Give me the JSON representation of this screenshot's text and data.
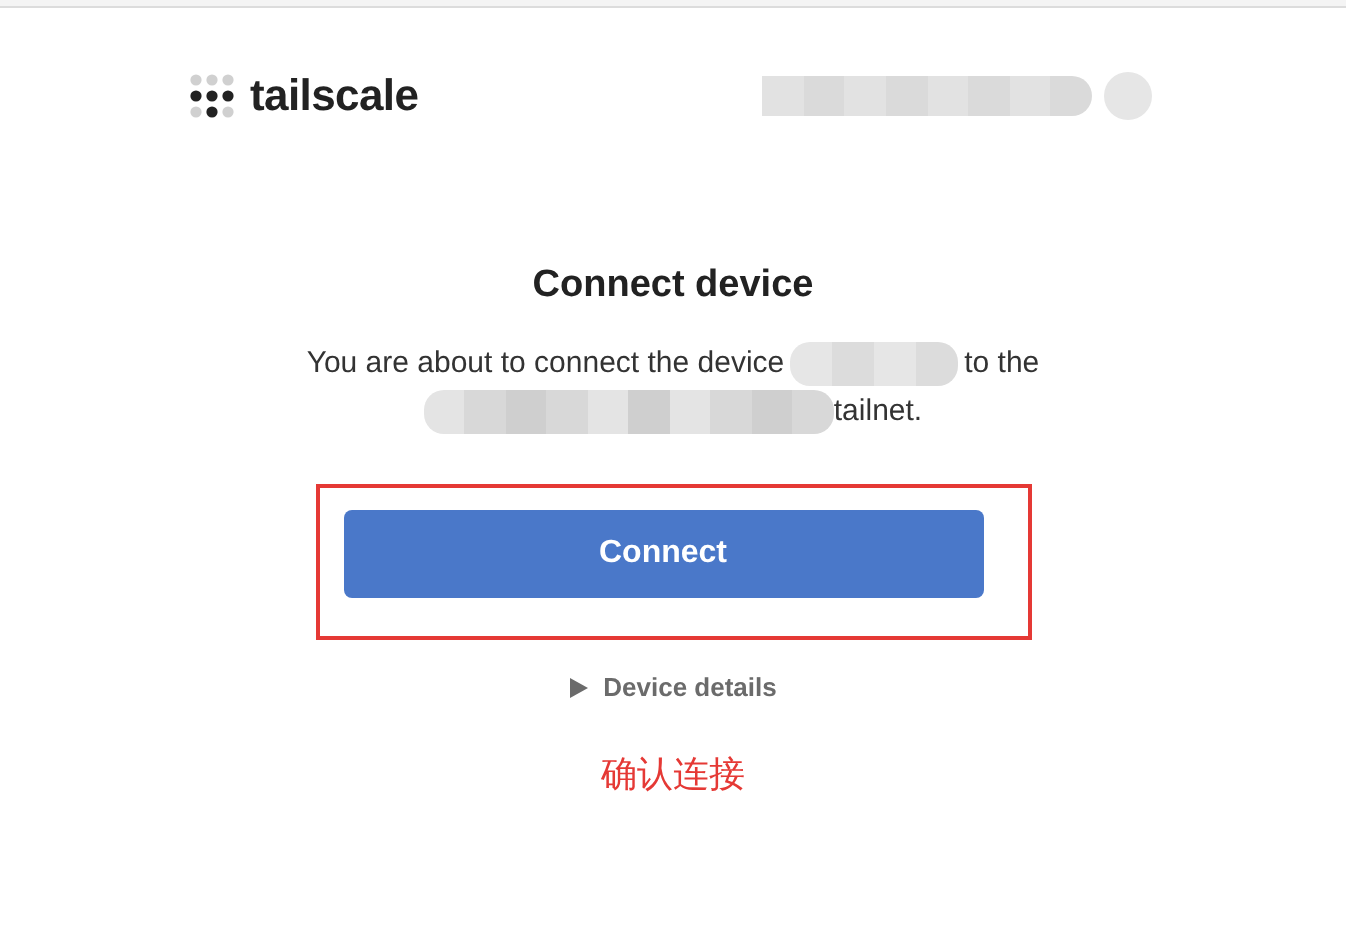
{
  "header": {
    "logo_text": "tailscale"
  },
  "title": "Connect device",
  "message": {
    "before": "You are about to connect the device",
    "middle": "to the",
    "after": "tailnet."
  },
  "connect_button": {
    "label": "Connect",
    "highlighted": true
  },
  "device_details": {
    "label": "Device details",
    "expanded": false
  },
  "annotation": "确认连接"
}
